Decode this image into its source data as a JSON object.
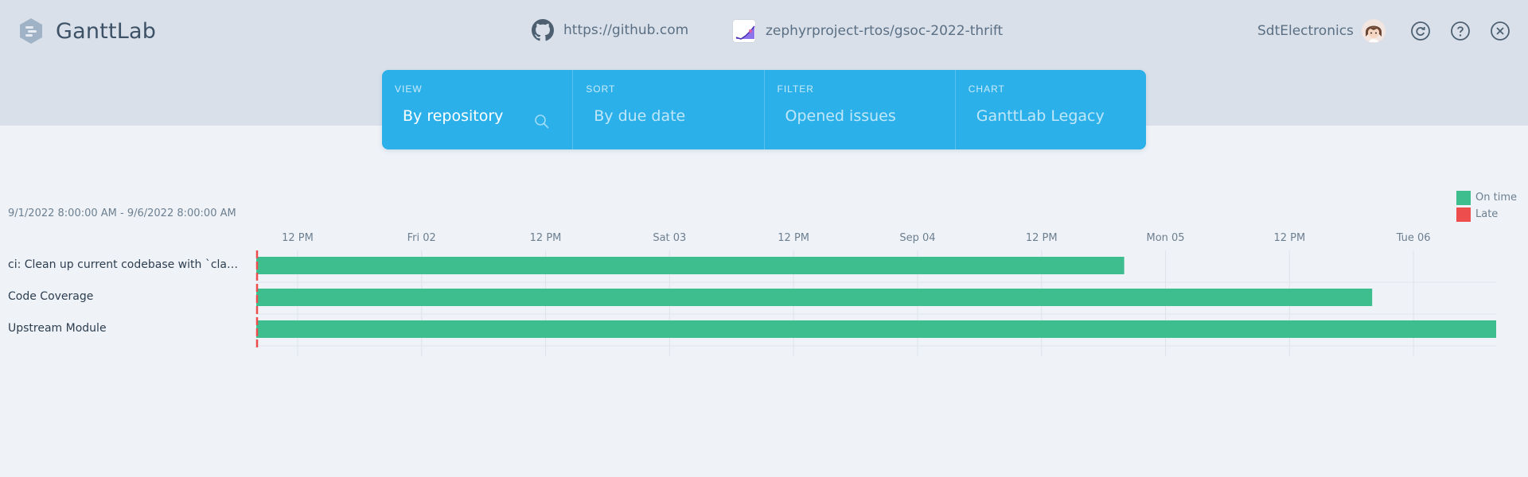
{
  "header": {
    "app_title": "GanttLab",
    "source_url": "https://github.com",
    "project_path": "zephyrproject-rtos/gsoc-2022-thrift",
    "username": "SdtElectronics",
    "icons": [
      "refresh-icon",
      "help-icon",
      "close-icon"
    ]
  },
  "toolbar": {
    "view": {
      "label": "VIEW",
      "value": "By repository"
    },
    "sort": {
      "label": "SORT",
      "value": "By due date"
    },
    "filter": {
      "label": "FILTER",
      "value": "Opened issues"
    },
    "chart": {
      "label": "CHART",
      "value": "GanttLab Legacy"
    }
  },
  "date_range": "9/1/2022 8:00:00 AM - 9/6/2022 8:00:00 AM",
  "legend": [
    {
      "label": "On time",
      "color": "#3ebd8f"
    },
    {
      "label": "Late",
      "color": "#ee4d4d"
    }
  ],
  "chart_data": {
    "type": "gantt",
    "tick_labels": [
      "12 PM",
      "Fri 02",
      "12 PM",
      "Sat 03",
      "12 PM",
      "Sep 04",
      "12 PM",
      "Mon 05",
      "12 PM",
      "Tue 06"
    ],
    "tasks": [
      {
        "name": "ci: Clean up current codebase with `clang-…",
        "start": "2022-09-01T08:00",
        "end": "2022-09-04T20:00",
        "status": "On time"
      },
      {
        "name": "Code Coverage",
        "start": "2022-09-01T08:00",
        "end": "2022-09-05T20:00",
        "status": "On time"
      },
      {
        "name": "Upstream Module",
        "start": "2022-09-01T08:00",
        "end": "2022-09-06T08:00",
        "status": "On time"
      }
    ],
    "today_marker": "2022-09-01T08:00"
  }
}
